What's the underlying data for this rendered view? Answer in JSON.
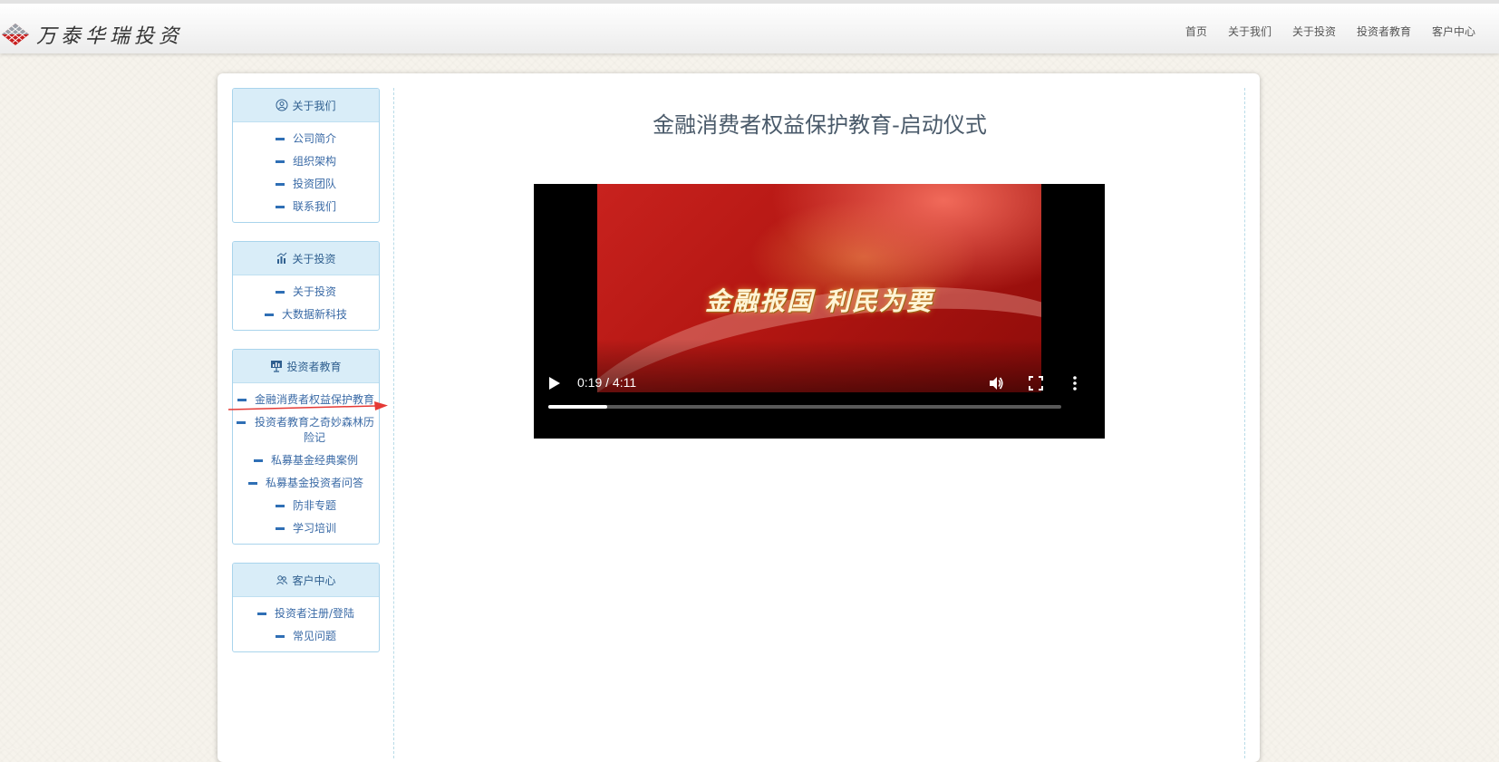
{
  "brand": {
    "name": "万泰华瑞投资",
    "logo": "diamond-lattice-logo",
    "color": "#c81f1f"
  },
  "nav": {
    "items": [
      {
        "label": "首页"
      },
      {
        "label": "关于我们"
      },
      {
        "label": "关于投资"
      },
      {
        "label": "投资者教育"
      },
      {
        "label": "客户中心"
      }
    ]
  },
  "sidebar": {
    "groups": [
      {
        "title": "关于我们",
        "icon": "user-circle-icon",
        "items": [
          "公司简介",
          "组织架构",
          "投资团队",
          "联系我们"
        ]
      },
      {
        "title": "关于投资",
        "icon": "bar-chart-icon",
        "items": [
          "关于投资",
          "大数据新科技"
        ]
      },
      {
        "title": "投资者教育",
        "icon": "presentation-icon",
        "items": [
          "金融消费者权益保护教育",
          "投资者教育之奇妙森林历险记",
          "私募基金经典案例",
          "私募基金投资者问答",
          "防非专题",
          "学习培训"
        ]
      },
      {
        "title": "客户中心",
        "icon": "users-icon",
        "items": [
          "投资者注册/登陆",
          "常见问题"
        ]
      }
    ]
  },
  "main": {
    "title": "金融消费者权益保护教育-启动仪式",
    "video": {
      "caption": "金融报国  利民为要",
      "time": "0:19 / 4:11",
      "progress": 0.115
    }
  },
  "colors": {
    "accent": "#2f6fb5",
    "panel_head": "#d9edf8",
    "annotation_arrow": "#e53935"
  }
}
